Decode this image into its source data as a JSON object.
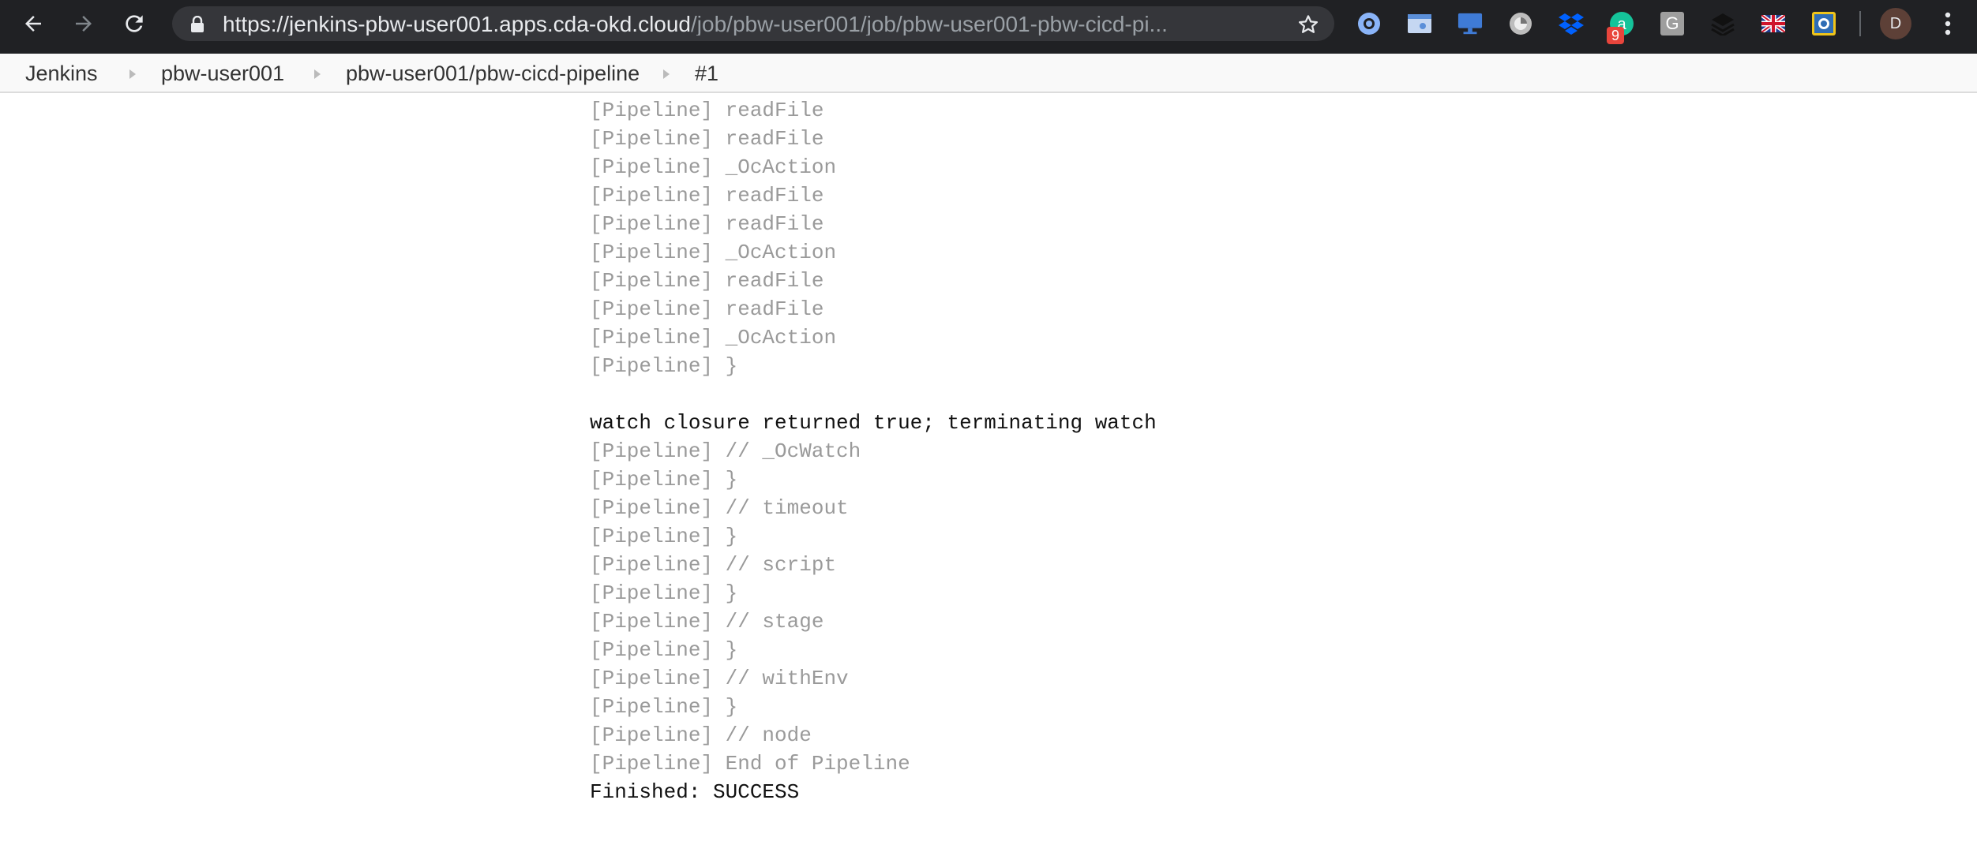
{
  "browser": {
    "url_host": "https://jenkins-pbw-user001.apps.cda-okd.cloud",
    "url_path": "/job/pbw-user001/job/pbw-user001-pbw-cicd-pi...",
    "extension_badge": "9",
    "extension_g_label": "G",
    "profile_initial": "D",
    "icons": [
      "back-icon",
      "forward-icon",
      "reload-icon",
      "lock-icon",
      "bookmark-star-icon",
      "menu-icon"
    ],
    "colors": {
      "toolbar": "#202124",
      "omnibox": "#35363a",
      "badge": "#e8453c"
    }
  },
  "breadcrumb": {
    "items": [
      "Jenkins",
      "pbw-user001",
      "pbw-user001/pbw-cicd-pipeline",
      "#1"
    ]
  },
  "console": {
    "lines": [
      {
        "text": "[Pipeline] readFile",
        "style": "pipeline"
      },
      {
        "text": "[Pipeline] readFile",
        "style": "pipeline"
      },
      {
        "text": "[Pipeline] _OcAction",
        "style": "pipeline"
      },
      {
        "text": "[Pipeline] readFile",
        "style": "pipeline"
      },
      {
        "text": "[Pipeline] readFile",
        "style": "pipeline"
      },
      {
        "text": "[Pipeline] _OcAction",
        "style": "pipeline"
      },
      {
        "text": "[Pipeline] readFile",
        "style": "pipeline"
      },
      {
        "text": "[Pipeline] readFile",
        "style": "pipeline"
      },
      {
        "text": "[Pipeline] _OcAction",
        "style": "pipeline"
      },
      {
        "text": "[Pipeline] }",
        "style": "pipeline"
      },
      {
        "text": "",
        "style": "blank"
      },
      {
        "text": "watch closure returned true; terminating watch",
        "style": "normal"
      },
      {
        "text": "[Pipeline] // _OcWatch",
        "style": "pipeline"
      },
      {
        "text": "[Pipeline] }",
        "style": "pipeline"
      },
      {
        "text": "[Pipeline] // timeout",
        "style": "pipeline"
      },
      {
        "text": "[Pipeline] }",
        "style": "pipeline"
      },
      {
        "text": "[Pipeline] // script",
        "style": "pipeline"
      },
      {
        "text": "[Pipeline] }",
        "style": "pipeline"
      },
      {
        "text": "[Pipeline] // stage",
        "style": "pipeline"
      },
      {
        "text": "[Pipeline] }",
        "style": "pipeline"
      },
      {
        "text": "[Pipeline] // withEnv",
        "style": "pipeline"
      },
      {
        "text": "[Pipeline] }",
        "style": "pipeline"
      },
      {
        "text": "[Pipeline] // node",
        "style": "pipeline"
      },
      {
        "text": "[Pipeline] End of Pipeline",
        "style": "pipeline"
      },
      {
        "text": "Finished: SUCCESS",
        "style": "normal"
      }
    ]
  }
}
